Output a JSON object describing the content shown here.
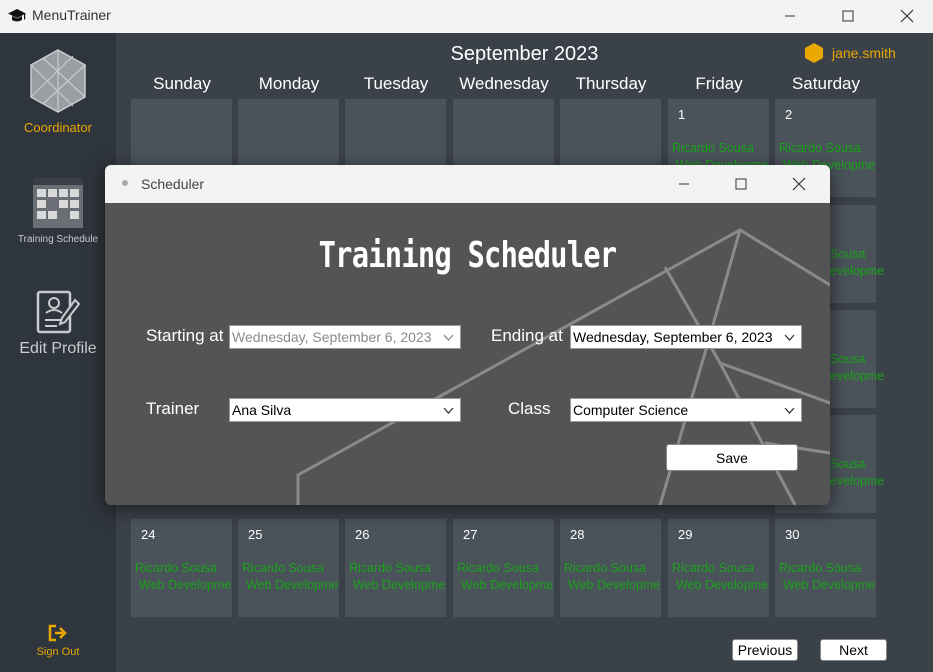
{
  "window": {
    "title": "MenuTrainer"
  },
  "sidebar": {
    "coordinator_label": "Coordinator",
    "training_schedule_label": "Training Schedule",
    "edit_profile_label": "Edit Profile",
    "sign_out_label": "Sign Out"
  },
  "calendar": {
    "month_title": "September 2023",
    "user": "jane.smith",
    "weekdays": [
      "Sunday",
      "Monday",
      "Tuesday",
      "Wednesday",
      "Thursday",
      "Friday",
      "Saturday"
    ],
    "week1": [
      {
        "day": "",
        "ev1": "",
        "ev2": ""
      },
      {
        "day": "",
        "ev1": "",
        "ev2": ""
      },
      {
        "day": "",
        "ev1": "",
        "ev2": ""
      },
      {
        "day": "",
        "ev1": "",
        "ev2": ""
      },
      {
        "day": "",
        "ev1": "",
        "ev2": ""
      },
      {
        "day": "1",
        "ev1": "Ricardo Sousa",
        "ev2": "Web Developme"
      },
      {
        "day": "2",
        "ev1": "Ricardo Sousa",
        "ev2": "Web Developme"
      }
    ],
    "right_column_partial": [
      {
        "ev1": "Sousa",
        "ev2": "evelopme"
      },
      {
        "ev1": "Sousa",
        "ev2": "evelopme"
      },
      {
        "ev1": "Sousa",
        "ev2": "evelopme"
      }
    ],
    "last_week": [
      {
        "day": "24",
        "ev1": "Ricardo Sousa",
        "ev2": "Web Developme"
      },
      {
        "day": "25",
        "ev1": "Ricardo Sousa",
        "ev2": "Web Developme"
      },
      {
        "day": "26",
        "ev1": "Ricardo Sousa",
        "ev2": "Web Developme"
      },
      {
        "day": "27",
        "ev1": "Ricardo Sousa",
        "ev2": "Web Developme"
      },
      {
        "day": "28",
        "ev1": "Ricardo Sousa",
        "ev2": "Web Developme"
      },
      {
        "day": "29",
        "ev1": "Ricardo Sousa",
        "ev2": "Web Developme"
      },
      {
        "day": "30",
        "ev1": "Ricardo Sousa",
        "ev2": "Web Developme"
      }
    ],
    "previous_label": "Previous",
    "next_label": "Next"
  },
  "dialog": {
    "title": "Scheduler",
    "heading": "Training Scheduler",
    "starting_label": "Starting at",
    "starting_value": "Wednesday, September   6, 2023",
    "ending_label": "Ending at",
    "ending_value": "Wednesday, September   6, 2023",
    "trainer_label": "Trainer",
    "trainer_value": "Ana Silva",
    "class_label": "Class",
    "class_value": "Computer Science",
    "save_label": "Save"
  },
  "colors": {
    "accent": "#e8a800",
    "event_text": "#1aa31a",
    "sidebar_bg": "#2f353c",
    "main_bg": "#3b4148",
    "cell_bg": "#4a525a",
    "dialog_bg": "#545454"
  },
  "icons": [
    "graduation-cap-icon",
    "minimize-icon",
    "maximize-icon",
    "close-icon",
    "hexagon-logo-icon",
    "calendar-grid-icon",
    "profile-edit-icon",
    "sign-out-icon",
    "user-hexagon-icon",
    "chevron-down-icon"
  ]
}
